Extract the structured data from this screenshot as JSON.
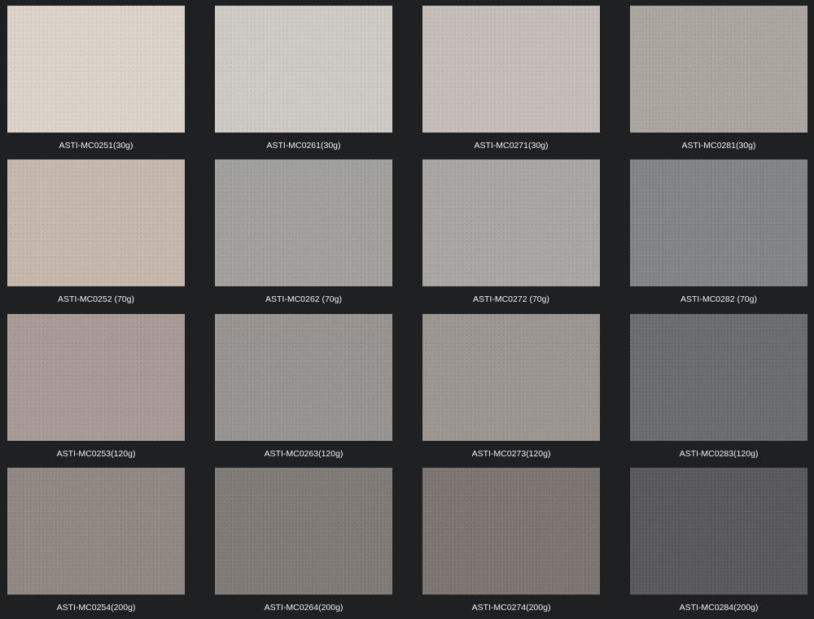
{
  "swatches": [
    {
      "label": "ASTI-MC0251(30g)",
      "color": "#dcd3ca"
    },
    {
      "label": "ASTI-MC0261(30g)",
      "color": "#cdc9c5"
    },
    {
      "label": "ASTI-MC0271(30g)",
      "color": "#c4bdb8"
    },
    {
      "label": "ASTI-MC0281(30g)",
      "color": "#aaa69f"
    },
    {
      "label": "ASTI-MC0252 (70g)",
      "color": "#c5b7ac"
    },
    {
      "label": "ASTI-MC0262 (70g)",
      "color": "#a09f9c"
    },
    {
      "label": "ASTI-MC0272 (70g)",
      "color": "#a9a5a2"
    },
    {
      "label": "ASTI-MC0282 (70g)",
      "color": "#818385"
    },
    {
      "label": "ASTI-MC0253(120g)",
      "color": "#a79a97"
    },
    {
      "label": "ASTI-MC0263(120g)",
      "color": "#979391"
    },
    {
      "label": "ASTI-MC0273(120g)",
      "color": "#9b9591"
    },
    {
      "label": "ASTI-MC0283(120g)",
      "color": "#6a6b6d"
    },
    {
      "label": "ASTI-MC0254(200g)",
      "color": "#918681"
    },
    {
      "label": "ASTI-MC0264(200g)",
      "color": "#807a77"
    },
    {
      "label": "ASTI-MC0274(200g)",
      "color": "#7c7470"
    },
    {
      "label": "ASTI-MC0284(200g)",
      "color": "#58585a"
    }
  ]
}
